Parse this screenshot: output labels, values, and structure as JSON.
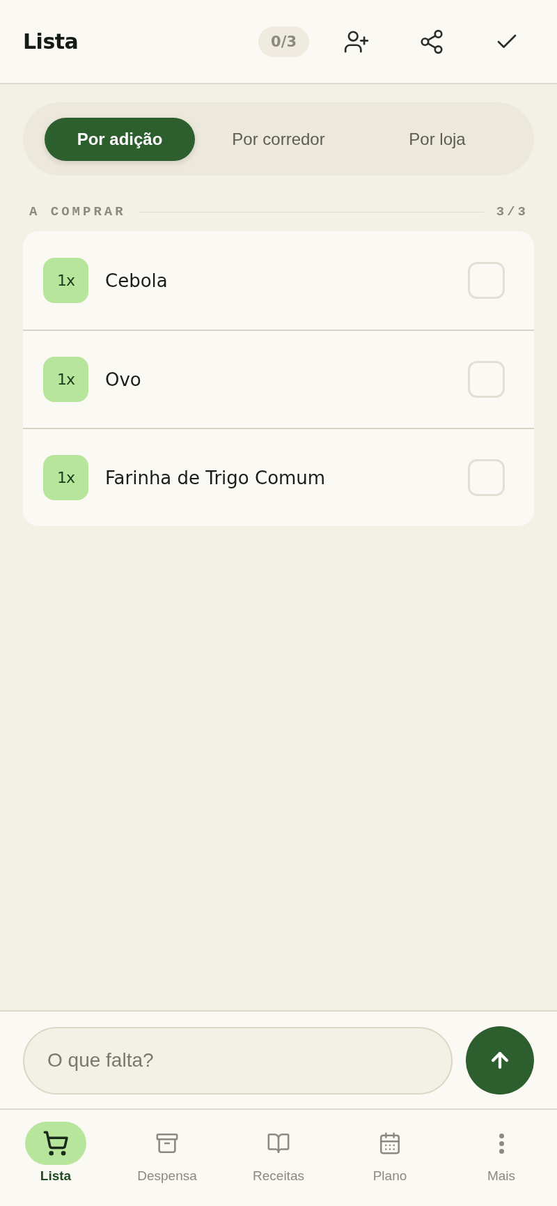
{
  "header": {
    "title": "Lista",
    "progress": "0/3"
  },
  "sort_tabs": [
    {
      "label": "Por adição",
      "selected": true
    },
    {
      "label": "Por corredor",
      "selected": false
    },
    {
      "label": "Por loja",
      "selected": false
    }
  ],
  "section": {
    "title": "A COMPRAR",
    "count": "3/3"
  },
  "items": [
    {
      "quantity": "1x",
      "name": "Cebola",
      "checked": false
    },
    {
      "quantity": "1x",
      "name": "Ovo",
      "checked": false
    },
    {
      "quantity": "1x",
      "name": "Farinha de Trigo Comum",
      "checked": false
    }
  ],
  "composer": {
    "placeholder": "O que falta?"
  },
  "nav": [
    {
      "label": "Lista",
      "selected": true
    },
    {
      "label": "Despensa",
      "selected": false
    },
    {
      "label": "Receitas",
      "selected": false
    },
    {
      "label": "Plano",
      "selected": false
    },
    {
      "label": "Mais",
      "selected": false
    }
  ]
}
